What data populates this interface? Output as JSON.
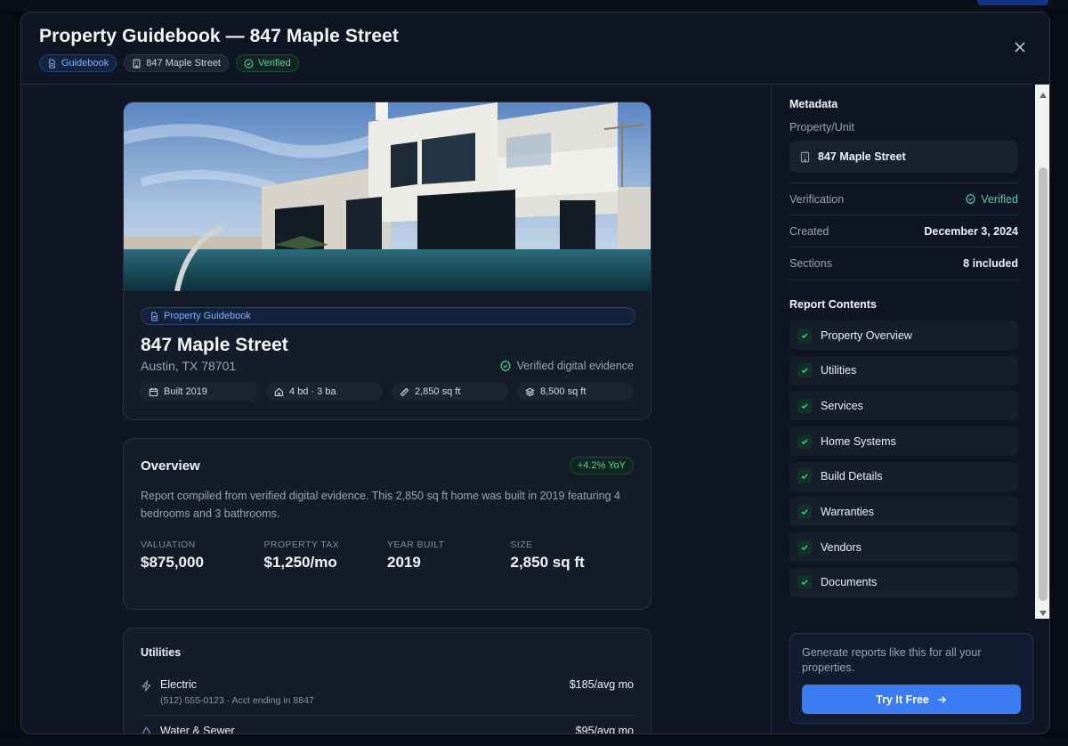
{
  "modal": {
    "title": "Property Guidebook — 847 Maple Street",
    "chips": {
      "type": "Guidebook",
      "property": "847 Maple Street",
      "status": "Verified"
    }
  },
  "hero": {
    "badge": "Property Guidebook",
    "address": "847 Maple Street",
    "city": "Austin, TX 78701",
    "evidence": "Verified digital evidence",
    "facts": {
      "built": "Built 2019",
      "rooms": "4 bd · 3 ba",
      "size": "2,850 sq ft",
      "lot": "8,500 sq ft"
    }
  },
  "overview": {
    "title": "Overview",
    "yoy": "+4.2% YoY",
    "description": "Report compiled from verified digital evidence. This 2,850 sq ft home was built in 2019 featuring 4 bedrooms and 3 bathrooms.",
    "stats": [
      {
        "label": "VALUATION",
        "value": "$875,000"
      },
      {
        "label": "PROPERTY TAX",
        "value": "$1,250/mo"
      },
      {
        "label": "YEAR BUILT",
        "value": "2019"
      },
      {
        "label": "SIZE",
        "value": "2,850 sq ft"
      }
    ]
  },
  "utilities": {
    "title": "Utilities",
    "rows": [
      {
        "name": "Electric",
        "sub": "(512) 555-0123 · Acct ending in 8847",
        "amount": "$185/avg mo"
      },
      {
        "name": "Water & Sewer",
        "sub": "",
        "amount": "$95/avg mo"
      }
    ]
  },
  "sidebar": {
    "metadata_heading": "Metadata",
    "unit_label": "Property/Unit",
    "unit_value": "847 Maple Street",
    "verification_key": "Verification",
    "verification_value": "Verified",
    "created_key": "Created",
    "created_value": "December 3, 2024",
    "sections_key": "Sections",
    "sections_value": "8 included",
    "contents_heading": "Report Contents",
    "contents": [
      "Property Overview",
      "Utilities",
      "Services",
      "Home Systems",
      "Build Details",
      "Warranties",
      "Vendors",
      "Documents"
    ]
  },
  "cta": {
    "text": "Generate reports like this for all your properties.",
    "button": "Try It Free"
  },
  "colors": {
    "accent": "#3b7cf2",
    "verified": "#4fd49a",
    "background": "#0f1522"
  }
}
